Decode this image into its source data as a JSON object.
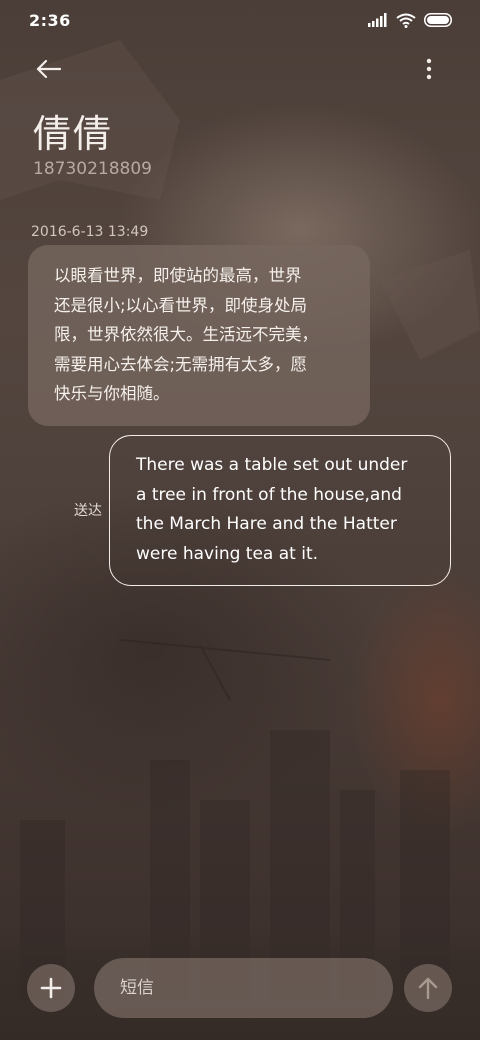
{
  "status_bar": {
    "time": "2:36",
    "icons": [
      "signal-icon",
      "wifi-icon",
      "battery-icon"
    ]
  },
  "header": {
    "back_icon": "arrow-left-icon",
    "more_icon": "more-vertical-icon"
  },
  "contact": {
    "name": "倩倩",
    "number": "18730218809"
  },
  "conversation": {
    "timestamp": "2016-6-13 13:49",
    "incoming": {
      "text": "以眼看世界，即使站的最高，世界\n还是很小;以心看世界，即使身处局\n限，世界依然很大。生活远不完美，\n需要用心去体会;无需拥有太多，愿\n快乐与你相随。"
    },
    "outgoing": {
      "text": "There was a table set out under\na tree in front of the house,and\nthe March Hare and the Hatter\nwere having tea at it.",
      "status": "送达"
    }
  },
  "composer": {
    "add_icon": "plus-icon",
    "placeholder": "短信",
    "send_icon": "arrow-up-icon"
  },
  "colors": {
    "background": "#4a3d37",
    "incoming_bubble": "#76675f",
    "text_primary": "#f3eeea",
    "text_secondary": "#b7aaa1"
  }
}
